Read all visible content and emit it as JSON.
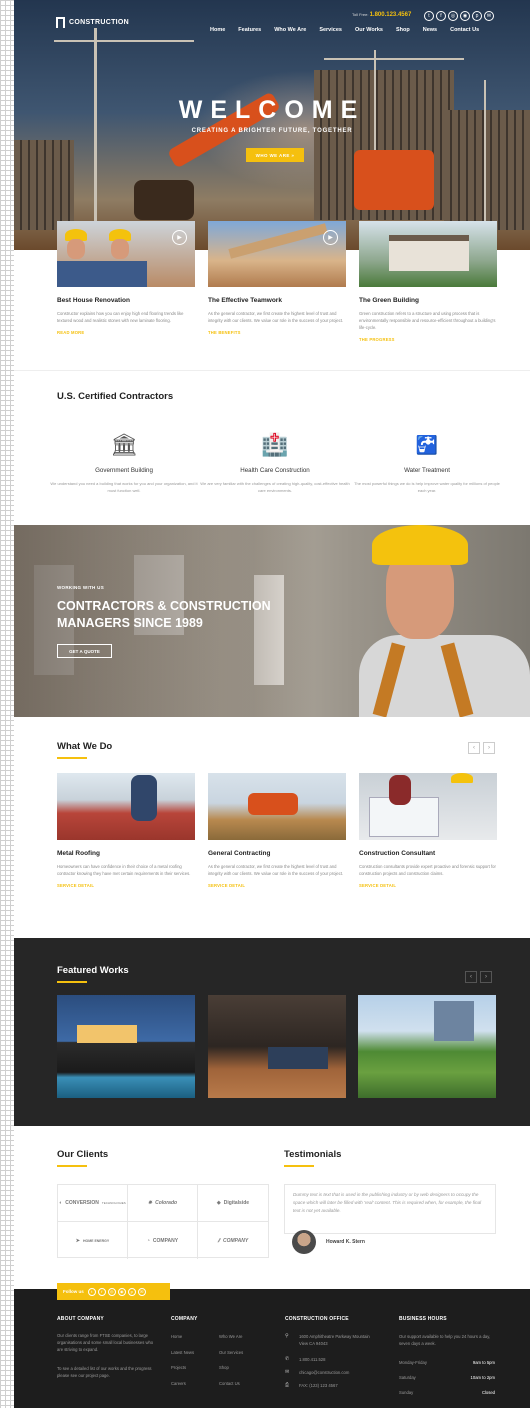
{
  "header": {
    "brand": "CONSTRUCTION",
    "toll_label": "Toll Free:",
    "toll_number": "1.800.123.4567",
    "socials": [
      "twitter-icon",
      "facebook-icon",
      "instagram-icon",
      "dribbble-icon",
      "pinterest-icon",
      "email-icon"
    ],
    "nav": [
      "Home",
      "Features",
      "Who We Are",
      "Services",
      "Our Works",
      "Shop",
      "News",
      "Contact Us"
    ]
  },
  "hero": {
    "title": "WELCOME",
    "tagline": "CREATING A BRIGHTER FUTURE, TOGETHER",
    "cta": "WHO WE ARE »"
  },
  "features": [
    {
      "title": "Best House Renovation",
      "text": "Constructor explains how you can enjoy high end flooring trends like textured wood and realistic stones with new laminate flooring.",
      "link": "READ MORE"
    },
    {
      "title": "The Effective Teamwork",
      "text": "As the general contractor, we first create the highest level of trust and integrity with our clients. We value our role in the success of your project.",
      "link": "THE BENEFITS"
    },
    {
      "title": "The Green Building",
      "text": "Green construction refers to a structure and using process that is environmentally responsible and resource-efficient throughout a building's life-cycle.",
      "link": "THE PROGRESS"
    }
  ],
  "certified": {
    "title": "U.S. Certified Contractors",
    "items": [
      {
        "title": "Government Building",
        "text": "We understand you need a building that works for you and your organization, and it must function well."
      },
      {
        "title": "Health Care Construction",
        "text": "We are very familiar with the challenges of creating high-quality, cost-effective health care environments."
      },
      {
        "title": "Water Treatment",
        "text": "The most powerful things we do is help improve water quality for millions of people each year."
      }
    ]
  },
  "banner": {
    "kicker": "WORKING WITH US",
    "title_line1": "CONTRACTORS & CONSTRUCTION",
    "title_line2": "MANAGERS SINCE 1989",
    "cta": "GET A QUOTE"
  },
  "what_we_do": {
    "title": "What We Do",
    "items": [
      {
        "title": "Metal Roofing",
        "text": "Homeowners can have confidence in their choice of a metal roofing contractor knowing they have met certain requirements in their services.",
        "link": "SERVICE DETAIL"
      },
      {
        "title": "General Contracting",
        "text": "As the general contractor, we first create the highest level of trust and integrity with our clients. We value our role in the success of your project.",
        "link": "SERVICE DETAIL"
      },
      {
        "title": "Construction Consultant",
        "text": "Construction consultants provide expert proactive and forensic support for construction projects and construction claims.",
        "link": "SERVICE DETAIL"
      }
    ]
  },
  "featured_works": {
    "title": "Featured Works"
  },
  "clients": {
    "title": "Our Clients",
    "logos": [
      {
        "name": "CONVERSION",
        "sub": "TECHNOLOGIES"
      },
      {
        "name": "Colorado"
      },
      {
        "name": "Digitalside"
      },
      {
        "name": "HOME ENERGY"
      },
      {
        "name": "COMPANY"
      },
      {
        "name": "COMPANY"
      }
    ]
  },
  "testimonials": {
    "title": "Testimonials",
    "quote": "Dummy text is text that is used in the publishing industry or by web designers to occupy the space which will later be filled with 'real' content. This is required when, for example, the final text is not yet available.",
    "author": "Howard K. Stern"
  },
  "footer": {
    "follow": "Follow us",
    "about": {
      "heading": "ABOUT COMPANY",
      "text1": "Our clients range from FTSE companies, to large organisations and some small local businesses who are striving to expand.",
      "text2": "To see a detailed list of our works and the progress please see our project page."
    },
    "company": {
      "heading": "COMPANY",
      "col1": [
        "Home",
        "Latest News",
        "Projects",
        "Careers"
      ],
      "col2": [
        "Who We Are",
        "Our Services",
        "Shop",
        "Contact Us"
      ]
    },
    "office": {
      "heading": "CONSTRUCTION OFFICE",
      "address": "1600 Amphitheatre Parkway Mountain View CA 94043",
      "phone": "1.800.411.528",
      "email": "chicago@construction.com",
      "fax": "FAX: (123) 123 4567"
    },
    "hours": {
      "heading": "BUSINESS HOURS",
      "text": "Our support available to help you 24 hours a day, seven days a week.",
      "rows": [
        {
          "day": "Monday-Friday",
          "time": "9am to 5pm"
        },
        {
          "day": "Saturday",
          "time": "10am to 2pm"
        },
        {
          "day": "Sunday",
          "time": "Closed"
        }
      ]
    }
  }
}
